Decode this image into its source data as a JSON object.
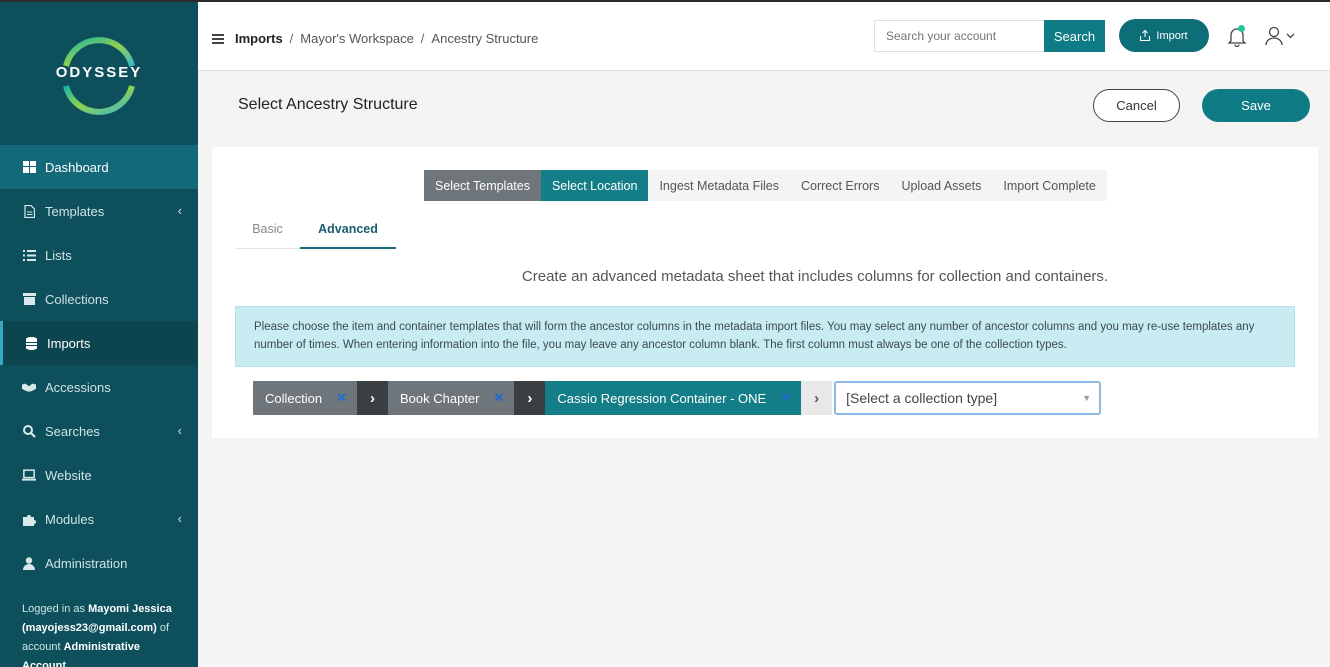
{
  "sidebar": {
    "logo_text": "ODYSSEY",
    "items": [
      {
        "label": "Dashboard"
      },
      {
        "label": "Templates"
      },
      {
        "label": "Lists"
      },
      {
        "label": "Collections"
      },
      {
        "label": "Imports"
      },
      {
        "label": "Accessions"
      },
      {
        "label": "Searches"
      },
      {
        "label": "Website"
      },
      {
        "label": "Modules"
      },
      {
        "label": "Administration"
      }
    ],
    "footer": {
      "prefix": "Logged in as ",
      "user": "Mayomi Jessica (mayojess23@gmail.com)",
      "middle": " of account ",
      "account": "Administrative Account"
    }
  },
  "header": {
    "breadcrumb": [
      "Imports",
      "Mayor's Workspace",
      "Ancestry Structure"
    ],
    "search_placeholder": "Search your account",
    "search_label": "Search",
    "import_label": "Import"
  },
  "page": {
    "title": "Select Ancestry Structure",
    "cancel_label": "Cancel",
    "save_label": "Save"
  },
  "steps": [
    "Select Templates",
    "Select Location",
    "Ingest Metadata Files",
    "Correct Errors",
    "Upload Assets",
    "Import Complete"
  ],
  "subtabs": {
    "basic": "Basic",
    "advanced": "Advanced"
  },
  "subtitle": "Create an advanced metadata sheet that includes columns for collection and containers.",
  "info": "Please choose the item and container templates that will form the ancestor columns in the metadata import files. You may select any number of ancestor columns and you may re-use templates any number of times. When entering information into the file, you may leave any ancestor column blank. The first column must always be one of the collection types.",
  "chain": {
    "chips": [
      {
        "label": "Collection"
      },
      {
        "label": "Book Chapter"
      },
      {
        "label": "Cassio Regression Container - ONE"
      }
    ],
    "remove_symbol": "✕",
    "select_value": "[Select a collection type]"
  },
  "colors": {
    "sidebar_bg": "#0e4f5c",
    "accent": "#0e7b85",
    "step_done": "#6e767b",
    "info_bg": "#c9ecf2"
  }
}
